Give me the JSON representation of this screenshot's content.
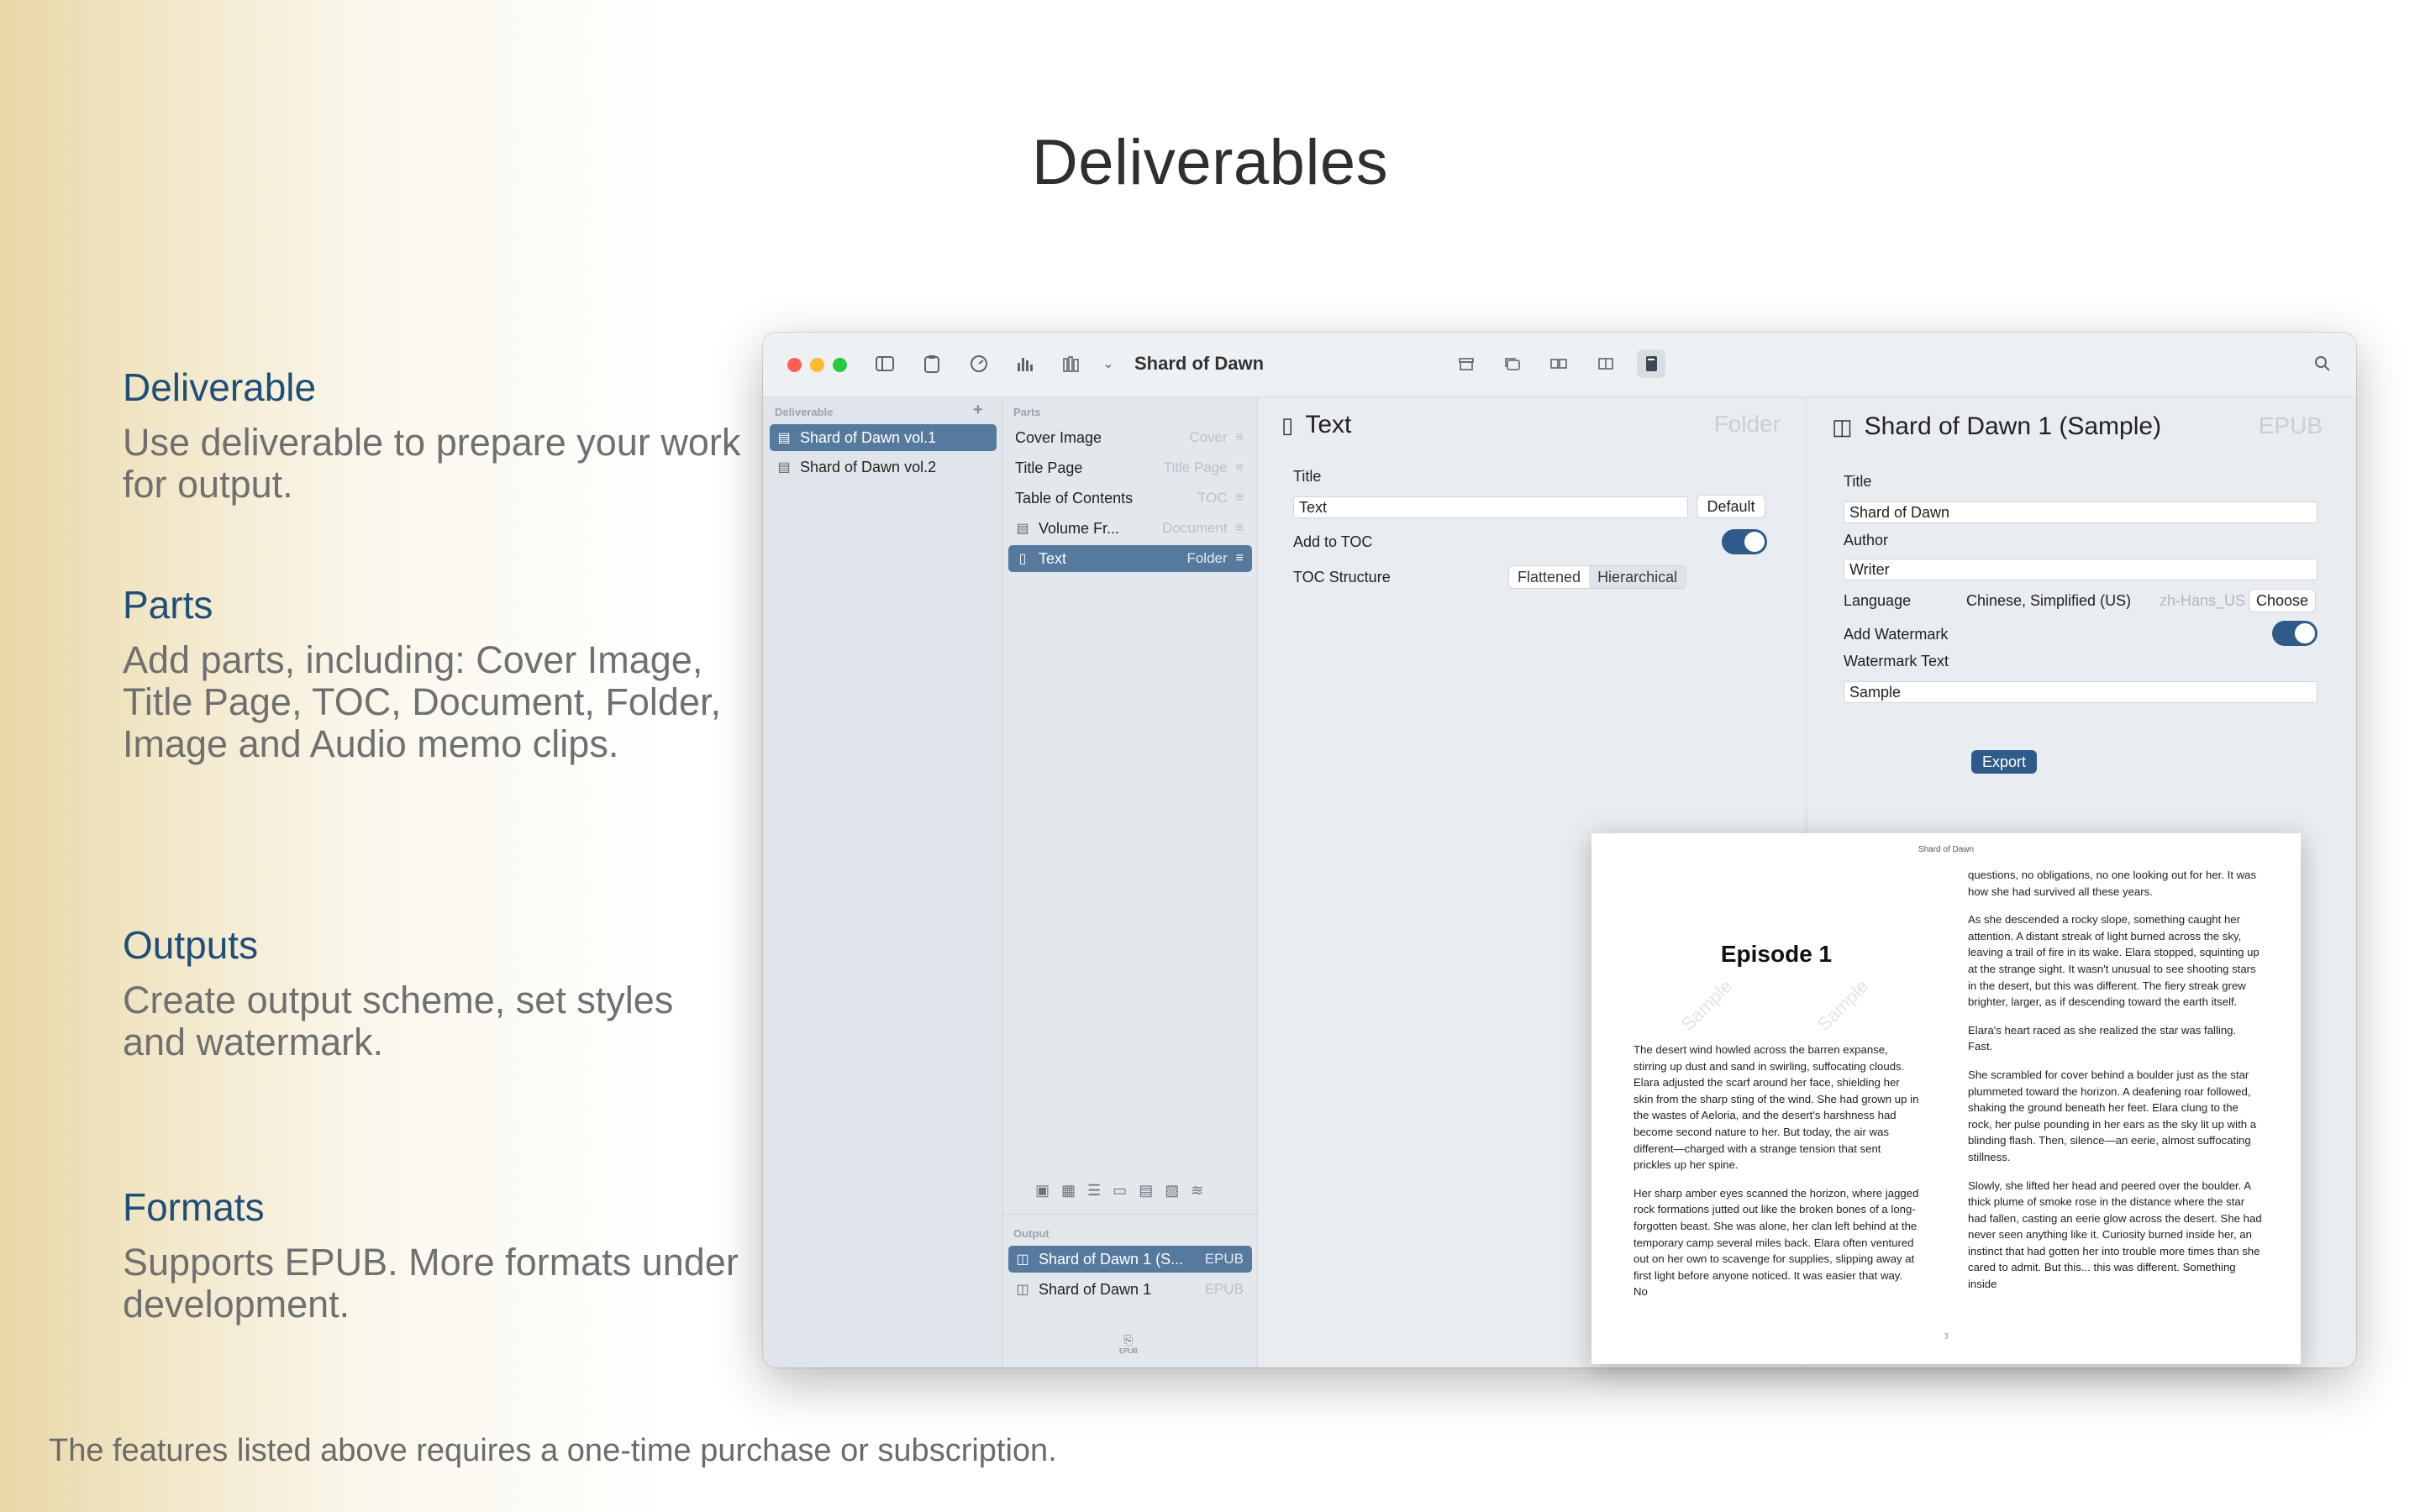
{
  "headline": "Deliverables",
  "features": [
    {
      "title": "Deliverable",
      "desc": "Use deliverable to prepare your work for output."
    },
    {
      "title": "Parts",
      "desc": "Add parts, including: Cover Image, Title Page, TOC, Document, Folder, Image and Audio memo clips."
    },
    {
      "title": "Outputs",
      "desc": "Create output scheme, set styles and watermark."
    },
    {
      "title": "Formats",
      "desc": "Supports EPUB. More formats under development."
    }
  ],
  "footnote": "The features listed above requires a one-time purchase or subscription.",
  "window": {
    "title": "Shard of Dawn",
    "deliverable": {
      "label": "Deliverable",
      "add": "+",
      "items": [
        "Shard of Dawn vol.1",
        "Shard of Dawn vol.2"
      ]
    },
    "parts": {
      "label": "Parts",
      "items": [
        {
          "name": "Cover Image",
          "type": "Cover"
        },
        {
          "name": "Title Page",
          "type": "Title Page"
        },
        {
          "name": "Table of Contents",
          "type": "TOC"
        },
        {
          "name": "Volume Fr...",
          "type": "Document"
        },
        {
          "name": "Text",
          "type": "Folder"
        }
      ]
    },
    "output": {
      "label": "Output",
      "items": [
        {
          "name": "Shard of Dawn 1 (S...",
          "type": "EPUB"
        },
        {
          "name": "Shard of Dawn 1",
          "type": "EPUB"
        }
      ],
      "footer_icon_text": "EPUB"
    },
    "part_pane": {
      "heading": "Text",
      "type": "Folder",
      "title_label": "Title",
      "title_value": "Text",
      "default_button": "Default",
      "add_toc_label": "Add to TOC",
      "toc_structure_label": "TOC Structure",
      "toc_options": [
        "Flattened",
        "Hierarchical"
      ]
    },
    "output_pane": {
      "heading": "Shard of Dawn 1 (Sample)",
      "type": "EPUB",
      "title_label": "Title",
      "title_value": "Shard of Dawn",
      "author_label": "Author",
      "author_value": "Writer",
      "language_label": "Language",
      "language_value": "Chinese, Simplified (US)",
      "language_code": "zh-Hans_US",
      "choose_button": "Choose",
      "watermark_label": "Add Watermark",
      "watermark_text_label": "Watermark Text",
      "watermark_text_value": "Sample",
      "export_button": "Export"
    },
    "preview": {
      "header": "Shard of Dawn",
      "episode": "Episode 1",
      "watermark": "Sample",
      "page_number": "3",
      "left_paragraphs": [
        "The desert wind howled across the barren expanse, stirring up dust and sand in swirling, suffocating clouds. Elara adjusted the scarf around her face, shielding her skin from the sharp sting of the wind. She had grown up in the wastes of Aeloria, and the desert's harshness had become second nature to her. But today, the air was different—charged with a strange tension that sent prickles up her spine.",
        "Her sharp amber eyes scanned the horizon, where jagged rock formations jutted out like the broken bones of a long-forgotten beast. She was alone, her clan left behind at the temporary camp several miles back. Elara often ventured out on her own to scavenge for supplies, slipping away at first light before anyone noticed. It was easier that way. No"
      ],
      "right_paragraphs": [
        "questions, no obligations, no one looking out for her. It was how she had survived all these years.",
        "As she descended a rocky slope, something caught her attention. A distant streak of light burned across the sky, leaving a trail of fire in its wake. Elara stopped, squinting up at the strange sight. It wasn't unusual to see shooting stars in the desert, but this was different. The fiery streak grew brighter, larger, as if descending toward the earth itself.",
        "Elara's heart raced as she realized the star was falling. Fast.",
        "She scrambled for cover behind a boulder just as the star plummeted toward the horizon. A deafening roar followed, shaking the ground beneath her feet. Elara clung to the rock, her pulse pounding in her ears as the sky lit up with a blinding flash. Then, silence—an eerie, almost suffocating stillness.",
        "Slowly, she lifted her head and peered over the boulder. A thick plume of smoke rose in the distance where the star had fallen, casting an eerie glow across the desert. She had never seen anything like it. Curiosity burned inside her, an instinct that had gotten her into trouble more times than she cared to admit. But this... this was different. Something inside"
      ]
    }
  },
  "colors": {
    "accent": "#1f4e79",
    "selection": "#56799e",
    "toggle": "#2f5b8a"
  }
}
